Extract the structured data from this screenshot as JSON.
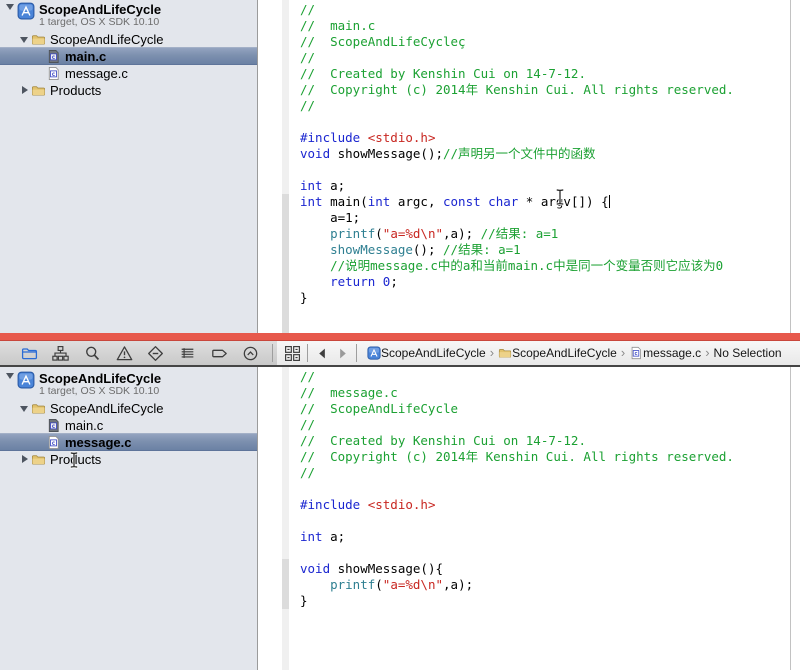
{
  "colors": {
    "keyword": "#1B26D0",
    "preprocessor": "#1B26D0",
    "string": "#C82721",
    "comment": "#1CA133",
    "function_call": "#2E7F91",
    "number": "#1B26D0",
    "red_divider": "#E7594C",
    "sidebar_selection": "#7D90AF",
    "sidebar_bg": "#E3E6EC",
    "nav_selected_icon": "#2A6BD5"
  },
  "top_pane": {
    "sidebar": {
      "rows": [
        {
          "type": "project",
          "level": 0,
          "disclosure": "open",
          "icon": "xcode-project",
          "label": "ScopeAndLifeCycle",
          "sublabel": "1 target, OS X SDK 10.10",
          "selected": false
        },
        {
          "type": "group",
          "level": 1,
          "disclosure": "open",
          "icon": "folder",
          "label": "ScopeAndLifeCycle",
          "selected": false
        },
        {
          "type": "file",
          "level": 2,
          "icon": "c-file-dark",
          "label": "main.c",
          "selected": true
        },
        {
          "type": "file",
          "level": 2,
          "icon": "c-file",
          "label": "message.c",
          "selected": false
        },
        {
          "type": "group",
          "level": 1,
          "disclosure": "closed",
          "icon": "folder",
          "label": "Products",
          "selected": false
        }
      ]
    },
    "editor": {
      "caret_line": 12,
      "lines": [
        [
          [
            "c",
            "//"
          ]
        ],
        [
          [
            "c",
            "//  main.c"
          ]
        ],
        [
          [
            "c",
            "//  ScopeAndLifeCycleç"
          ]
        ],
        [
          [
            "c",
            "//"
          ]
        ],
        [
          [
            "c",
            "//  Created by Kenshin Cui on 14-7-12."
          ]
        ],
        [
          [
            "c",
            "//  Copyright (c) 2014年 Kenshin Cui. All rights reserved."
          ]
        ],
        [
          [
            "c",
            "//"
          ]
        ],
        [],
        [
          [
            "p",
            "#include "
          ],
          [
            "s",
            "<stdio.h>"
          ]
        ],
        [
          [
            "k",
            "void"
          ],
          [
            "t",
            " showMessage();"
          ],
          [
            "c",
            "//声明另一个文件中的函数"
          ]
        ],
        [],
        [
          [
            "k",
            "int"
          ],
          [
            "t",
            " a;"
          ]
        ],
        [
          [
            "k",
            "int"
          ],
          [
            "t",
            " main("
          ],
          [
            "k",
            "int"
          ],
          [
            "t",
            " argc, "
          ],
          [
            "k",
            "const"
          ],
          [
            "t",
            " "
          ],
          [
            "k",
            "char"
          ],
          [
            "t",
            " * argv[]) {"
          ]
        ],
        [
          [
            "t",
            "    a=1;"
          ]
        ],
        [
          [
            "t",
            "    "
          ],
          [
            "f",
            "printf"
          ],
          [
            "t",
            "("
          ],
          [
            "s",
            "\"a=%d\\n\""
          ],
          [
            "t",
            ",a); "
          ],
          [
            "c",
            "//结果: a=1"
          ]
        ],
        [
          [
            "t",
            "    "
          ],
          [
            "f",
            "showMessage"
          ],
          [
            "t",
            "(); "
          ],
          [
            "c",
            "//结果: a=1"
          ]
        ],
        [
          [
            "t",
            "    "
          ],
          [
            "c",
            "//说明message.c中的a和当前main.c中是同一个变量否则它应该为0"
          ]
        ],
        [
          [
            "t",
            "    "
          ],
          [
            "k",
            "return"
          ],
          [
            "t",
            " "
          ],
          [
            "n",
            "0"
          ],
          [
            "t",
            ";"
          ]
        ],
        [
          [
            "t",
            "}"
          ]
        ]
      ]
    }
  },
  "navigator_bar": {
    "icons": [
      {
        "name": "project-navigator",
        "icon": "nav-folder",
        "selected": true
      },
      {
        "name": "symbol-navigator",
        "icon": "nav-symbol",
        "selected": false
      },
      {
        "name": "search-navigator",
        "icon": "nav-search",
        "selected": false
      },
      {
        "name": "issue-navigator",
        "icon": "nav-issue",
        "selected": false
      },
      {
        "name": "test-navigator",
        "icon": "nav-test",
        "selected": false
      },
      {
        "name": "debug-navigator",
        "icon": "nav-debug",
        "selected": false
      },
      {
        "name": "breakpoint-navigator",
        "icon": "nav-breakpoint",
        "selected": false
      },
      {
        "name": "report-navigator",
        "icon": "nav-report",
        "selected": false
      }
    ],
    "related_items_icon": "related",
    "back_icon": "back",
    "forward_icon": "forward",
    "breadcrumb": {
      "separator": "›",
      "items": [
        {
          "icon": "xcode-project",
          "label": "ScopeAndLifeCycle"
        },
        {
          "icon": "folder",
          "label": "ScopeAndLifeCycle"
        },
        {
          "icon": "c-file",
          "label": "message.c"
        },
        {
          "icon": null,
          "label": "No Selection"
        }
      ]
    }
  },
  "bottom_pane": {
    "sidebar": {
      "rows": [
        {
          "type": "project",
          "level": 0,
          "disclosure": "open",
          "icon": "xcode-project",
          "label": "ScopeAndLifeCycle",
          "sublabel": "1 target, OS X SDK 10.10",
          "selected": false
        },
        {
          "type": "group",
          "level": 1,
          "disclosure": "open",
          "icon": "folder",
          "label": "ScopeAndLifeCycle",
          "selected": false
        },
        {
          "type": "file",
          "level": 2,
          "icon": "c-file-dark",
          "label": "main.c",
          "selected": false
        },
        {
          "type": "file",
          "level": 2,
          "icon": "c-file",
          "label": "message.c",
          "selected": true
        },
        {
          "type": "group",
          "level": 1,
          "disclosure": "closed",
          "icon": "folder",
          "label": "Products",
          "selected": false
        }
      ]
    },
    "editor": {
      "lines": [
        [
          [
            "c",
            "//"
          ]
        ],
        [
          [
            "c",
            "//  message.c"
          ]
        ],
        [
          [
            "c",
            "//  ScopeAndLifeCycle"
          ]
        ],
        [
          [
            "c",
            "//"
          ]
        ],
        [
          [
            "c",
            "//  Created by Kenshin Cui on 14-7-12."
          ]
        ],
        [
          [
            "c",
            "//  Copyright (c) 2014年 Kenshin Cui. All rights reserved."
          ]
        ],
        [
          [
            "c",
            "//"
          ]
        ],
        [],
        [
          [
            "p",
            "#include "
          ],
          [
            "s",
            "<stdio.h>"
          ]
        ],
        [],
        [
          [
            "k",
            "int"
          ],
          [
            "t",
            " a;"
          ]
        ],
        [],
        [
          [
            "k",
            "void"
          ],
          [
            "t",
            " showMessage(){"
          ]
        ],
        [
          [
            "t",
            "    "
          ],
          [
            "f",
            "printf"
          ],
          [
            "t",
            "("
          ],
          [
            "s",
            "\"a=%d\\n\""
          ],
          [
            "t",
            ",a);"
          ]
        ],
        [
          [
            "t",
            "}"
          ]
        ]
      ]
    }
  }
}
